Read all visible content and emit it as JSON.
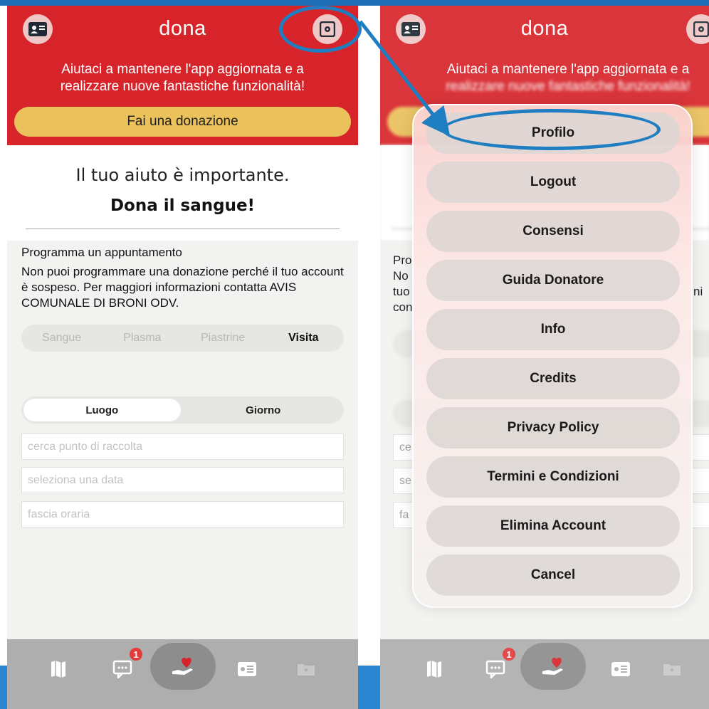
{
  "app": {
    "title": "dona"
  },
  "banner": {
    "line1": "Aiutaci a mantenere l'app aggiornata e a",
    "line2": "realizzare nuove fantastiche funzionalità!",
    "donate_label": "Fai una donazione"
  },
  "hero": {
    "tagline": "Il tuo aiuto è importante.",
    "headline": "Dona il sangue!"
  },
  "schedule": {
    "title": "Programma un appuntamento",
    "message": "Non puoi programmare una donazione perché il tuo account è sospeso. Per maggiori informazioni contatta AVIS COMUNALE DI BRONI ODV.",
    "types": [
      "Sangue",
      "Plasma",
      "Piastrine",
      "Visita"
    ],
    "selected_type": "Visita",
    "modes": [
      "Luogo",
      "Giorno"
    ],
    "selected_mode": "Luogo",
    "location_placeholder": "cerca punto di raccolta",
    "date_placeholder": "seleziona una data",
    "time_placeholder": "fascia oraria"
  },
  "tabbar": {
    "tabs": [
      "map-icon",
      "chat-icon",
      "donate-heart-icon",
      "id-card-icon",
      "folder-icon"
    ],
    "chat_badge": "1"
  },
  "settings_menu": {
    "items": [
      "Profilo",
      "Logout",
      "Consensi",
      "Guida Donatore",
      "Info",
      "Credits",
      "Privacy Policy",
      "Termini e Condizioni",
      "Elimina Account",
      "Cancel"
    ]
  },
  "right_partial": {
    "prog": "Pro",
    "no": "No",
    "tuo": "tuo",
    "con": "con",
    "ni": "ni",
    "ce": "ce",
    "se": "se",
    "fa": "fa"
  },
  "colors": {
    "header_red": "#d7242a",
    "donate_yellow": "#ebc15c",
    "annotation_blue": "#1f7ec2"
  }
}
